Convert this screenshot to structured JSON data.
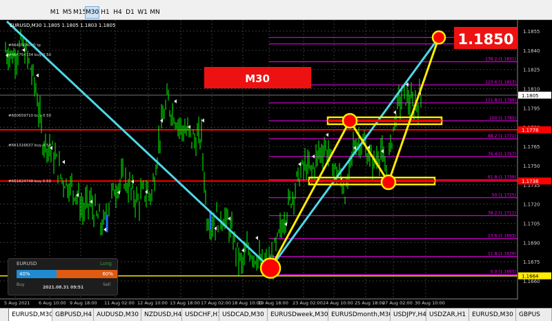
{
  "toolbar": {
    "timeframes": [
      "M1",
      "M5",
      "M15",
      "M30",
      "H1",
      "H4",
      "D1",
      "W1",
      "MN"
    ],
    "active_timeframe": "M30"
  },
  "chart": {
    "header_text": "EURUSD,M30  1.1805 1.1805 1.1803 1.1805",
    "timeframe_badge": "M30",
    "target_label": "1.1850",
    "price_axis": [
      "1.1855",
      "1.1840",
      "1.1825",
      "1.1810",
      "1.1795",
      "1.1780",
      "1.1765",
      "1.1750",
      "1.1735",
      "1.1720",
      "1.1705",
      "1.1690",
      "1.1675",
      "1.1660"
    ],
    "time_axis": [
      "5 Aug 2021",
      "6 Aug 10:00",
      "9 Aug 18:00",
      "11 Aug 02:00",
      "12 Aug 10:00",
      "13 Aug 18:00",
      "17 Aug 02:00",
      "18 Aug 10:00",
      "19 Aug 18:00",
      "23 Aug 02:00",
      "24 Aug 10:00",
      "25 Aug 18:00",
      "27 Aug 02:00",
      "30 Aug 10:00"
    ],
    "fib_levels": [
      {
        "label": "161.8",
        "price": "1.1850"
      },
      {
        "label": "150",
        "price": "1.1845"
      },
      {
        "label": "138.2",
        "price": "1.1831"
      },
      {
        "label": "123.6",
        "price": "1.1813"
      },
      {
        "label": "111.8",
        "price": "1.1799"
      },
      {
        "label": "100",
        "price": "1.1785"
      },
      {
        "label": "88.2",
        "price": "1.1771"
      },
      {
        "label": "76.4",
        "price": "1.1757"
      },
      {
        "label": "61.8",
        "price": "1.1739"
      },
      {
        "label": "50",
        "price": "1.1725"
      },
      {
        "label": "38.2",
        "price": "1.1711"
      },
      {
        "label": "23.6",
        "price": "1.1693"
      },
      {
        "label": "11.8",
        "price": "1.1679"
      },
      {
        "label": "0.0",
        "price": "1.1665"
      }
    ],
    "price_badges": {
      "current": "1.1805",
      "red_upper": "1.1778",
      "red_lower": "1.1738",
      "yellow_bottom": "1.1664"
    },
    "order_labels": [
      "#6646504000 tp",
      "#664754734 buy 0.50",
      "#660659710 buy 0.50",
      "#661316637 buy 0.50",
      "#661824748 buy 0.50"
    ]
  },
  "widget": {
    "symbol": "EURUSD",
    "direction": "Long",
    "buy_pct": "40%",
    "sell_pct": "60%",
    "buy_label": "Buy",
    "sell_label": "Sell",
    "datetime": "2021.08.31 09:51"
  },
  "tabs": [
    "EURUSD,M30",
    "GBPUSD,H4",
    "AUDUSD,M30",
    "NZDUSD,H4",
    "USDCHF,H1",
    "USDCAD,M30",
    "EURUSDweek,M30",
    "EURUSDmonth,M30",
    "USDJPY,H4",
    "USDZAR,H1",
    "EURUSD,M30",
    "GBPUS"
  ],
  "colors": {
    "bg": "#000000",
    "candles": "#00ff00",
    "grid": "#3a3a3a",
    "fib": "#ff00ff",
    "trend": "#4dd9e8",
    "red": "#ff0000",
    "yellow": "#ffee00",
    "markers": "#e8e8e8"
  }
}
